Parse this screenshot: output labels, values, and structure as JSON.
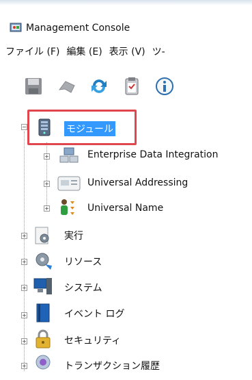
{
  "window": {
    "title": "Management Console"
  },
  "menu": [
    "ファイル (F)",
    "編集 (E)",
    "表示 (V)",
    "ツ-"
  ],
  "toolbar": {
    "icons": [
      "save-icon",
      "undo-icon",
      "refresh-icon",
      "clipboard-icon",
      "info-icon"
    ]
  },
  "tree": {
    "root": {
      "label": "モジュール",
      "icon": "server-icon"
    },
    "children": [
      {
        "label": "Enterprise Data Integration",
        "icon": "data-integration-icon"
      },
      {
        "label": "Universal Addressing",
        "icon": "address-card-icon"
      },
      {
        "label": "Universal Name",
        "icon": "person-icon"
      }
    ],
    "items": [
      {
        "label": "実行",
        "icon": "gear-icon"
      },
      {
        "label": "リソース",
        "icon": "resources-icon"
      },
      {
        "label": "システム",
        "icon": "monitor-icon"
      },
      {
        "label": "イベント ログ",
        "icon": "book-icon"
      },
      {
        "label": "セキュリティ",
        "icon": "lock-icon"
      },
      {
        "label": "トランザクション履歴",
        "icon": "history-icon"
      }
    ]
  },
  "colors": {
    "selection": "#3399ff",
    "highlight_box": "#e0464e"
  }
}
